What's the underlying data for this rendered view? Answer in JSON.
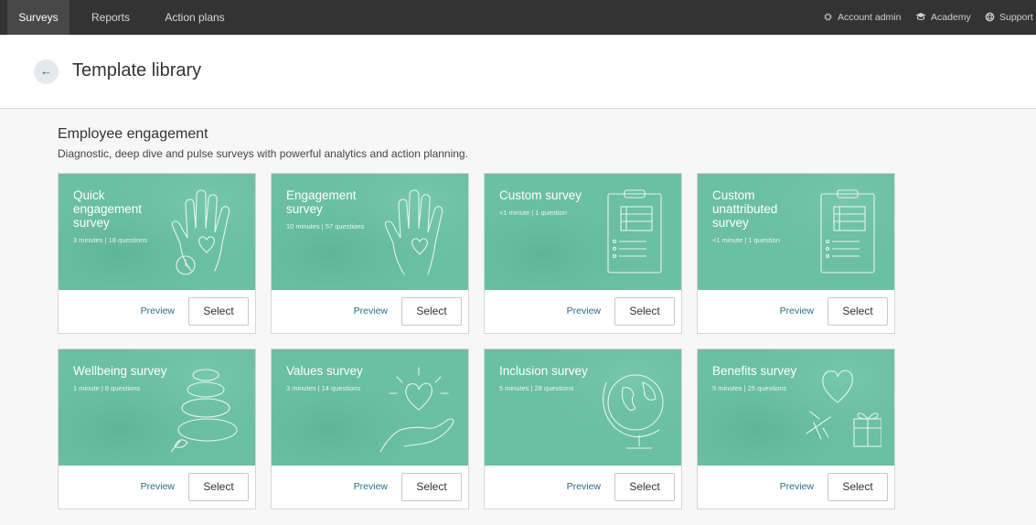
{
  "nav": {
    "tabs": [
      "Surveys",
      "Reports",
      "Action plans"
    ],
    "account_admin": "Account admin",
    "academy": "Academy",
    "support": "Support"
  },
  "header": {
    "back_icon": "←",
    "title": "Template library"
  },
  "section": {
    "title": "Employee engagement",
    "description": "Diagnostic, deep dive and pulse surveys with powerful analytics and action planning."
  },
  "colors": {
    "card_green": "#6bbfa3",
    "nav_bg": "#333333",
    "link": "#2d6a8a"
  },
  "cards": [
    {
      "title": "Quick engagement survey",
      "meta": "3 minutes  |  18 questions",
      "icon": "hand-heart-clock-icon",
      "preview": "Preview",
      "select": "Select"
    },
    {
      "title": "Engagement survey",
      "meta": "10 minutes  |  57 questions",
      "icon": "hand-heart-icon",
      "preview": "Preview",
      "select": "Select"
    },
    {
      "title": "Custom survey",
      "meta": "<1 minute  |  1 question",
      "icon": "clipboard-icon",
      "preview": "Preview",
      "select": "Select"
    },
    {
      "title": "Custom unattributed survey",
      "meta": "<1 minute  |  1 question",
      "icon": "clipboard-icon",
      "preview": "Preview",
      "select": "Select"
    },
    {
      "title": "Wellbeing survey",
      "meta": "1 minute  |  8 questions",
      "icon": "zen-stones-icon",
      "preview": "Preview",
      "select": "Select"
    },
    {
      "title": "Values survey",
      "meta": "3 minutes  |  14 questions",
      "icon": "hand-holding-heart-icon",
      "preview": "Preview",
      "select": "Select"
    },
    {
      "title": "Inclusion survey",
      "meta": "5 minutes  |  28 questions",
      "icon": "globe-icon",
      "preview": "Preview",
      "select": "Select"
    },
    {
      "title": "Benefits survey",
      "meta": "5 minutes  |  25 questions",
      "icon": "heart-plane-gift-icon",
      "preview": "Preview",
      "select": "Select"
    }
  ]
}
